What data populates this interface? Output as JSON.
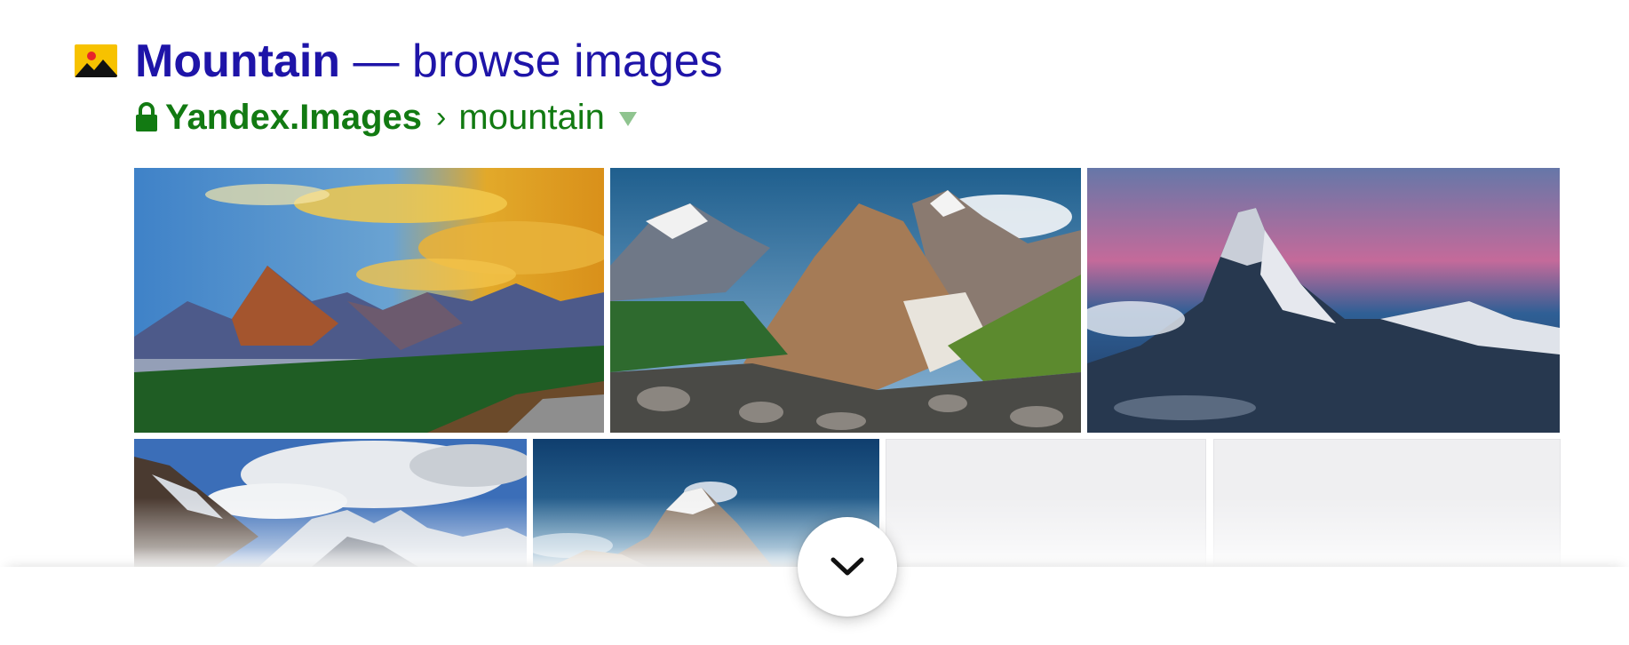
{
  "result": {
    "title_bold": "Mountain",
    "title_rest": " — browse images",
    "favicon_icon": "image-icon",
    "path": {
      "lock_icon": "lock-icon",
      "host": "Yandex.Images",
      "separator": "›",
      "crumb": "mountain",
      "menu_icon": "triangle-down-icon"
    }
  },
  "gallery": {
    "thumbnails": [
      {
        "name": "image-thumbnail-1",
        "subject": "mountain range at sunrise with pine forest"
      },
      {
        "name": "image-thumbnail-2",
        "subject": "rocky peaks over green valley"
      },
      {
        "name": "image-thumbnail-3",
        "subject": "snowy peak at dusk"
      },
      {
        "name": "image-thumbnail-4",
        "subject": "snowy peaks under cloudy sky"
      },
      {
        "name": "image-thumbnail-5",
        "subject": "snow-capped summit with blue sky"
      }
    ],
    "placeholders": 2,
    "expand_icon": "chevron-down-icon"
  },
  "colors": {
    "title": "#1e14a8",
    "path": "#127a12",
    "favicon": "#f7c200"
  }
}
